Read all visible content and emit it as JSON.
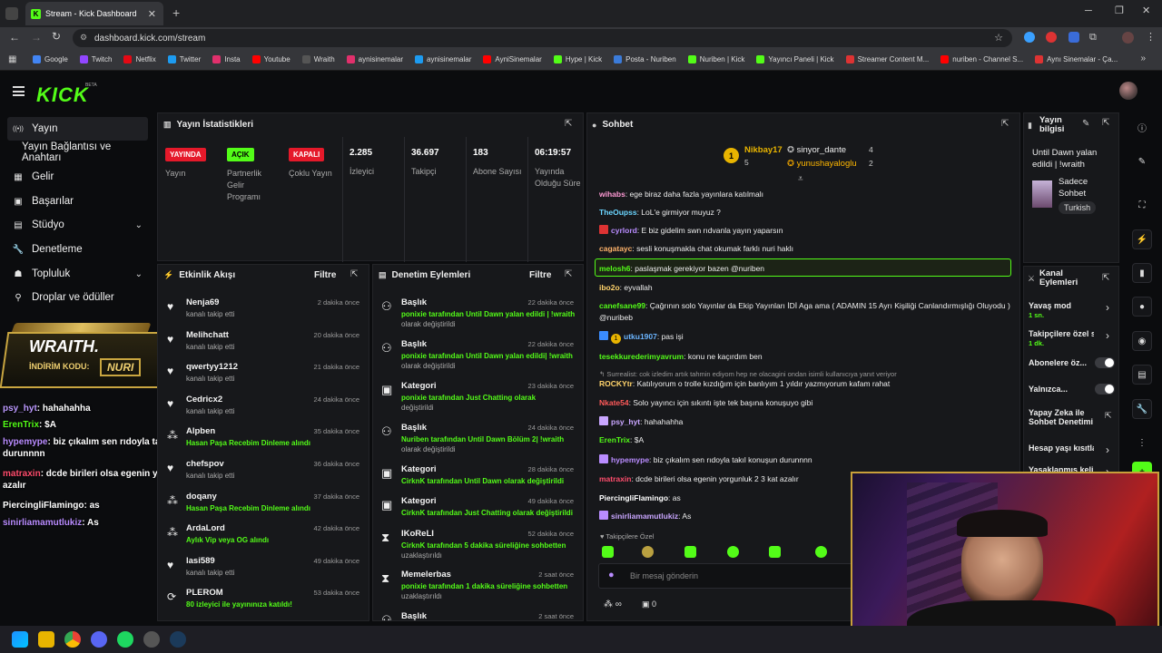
{
  "browser": {
    "tab_title": "Stream - Kick Dashboard",
    "url": "dashboard.kick.com/stream",
    "bookmarks": [
      "Google",
      "Twitch",
      "Netflix",
      "Twitter",
      "Insta",
      "Youtube",
      "Wraith",
      "aynisinemalar",
      "aynisinemalar",
      "AyniSinemalar",
      "Hype | Kick",
      "Posta - Nuriben",
      "Nuriben | Kick",
      "Yayıncı Paneli | Kick",
      "Streamer Content M...",
      "nuriben - Channel S...",
      "Aynı Sinemalar - Ça..."
    ]
  },
  "brand": {
    "logo": "KICK",
    "beta": "BETA",
    "accent": "#53fc18"
  },
  "sidebar": {
    "items": [
      {
        "label": "Yayın",
        "icon": "broadcast-icon"
      },
      {
        "label": "Yayın Bağlantısı ve Anahtarı",
        "icon": ""
      },
      {
        "label": "Gelir",
        "icon": "bank-icon"
      },
      {
        "label": "Başarılar",
        "icon": "achievements-icon"
      },
      {
        "label": "Stüdyo",
        "icon": "studio-icon"
      },
      {
        "label": "Denetleme",
        "icon": "wrench-icon"
      },
      {
        "label": "Topluluk",
        "icon": "community-icon"
      },
      {
        "label": "Droplar ve ödüller",
        "icon": "drops-icon"
      }
    ]
  },
  "overlay": {
    "wraith_title": "WRAITH.",
    "code_label": "İNDİRİM KODU:",
    "code": "NURI",
    "chat": [
      {
        "user": "psy_hyt",
        "text": ": hahahahha",
        "color": "#b9f"
      },
      {
        "user": "ErenTrix",
        "text": ": $A",
        "color": "#53fc18"
      },
      {
        "user": "hypemype",
        "text": ": biz çıkalım sen rıdoyla takıl konuşun durunnnn",
        "color": "#b98cff"
      },
      {
        "user": "matraxin",
        "text": ": dcde birileri olsa egenin yorgunluk 2 3 kat azalır",
        "color": "#ff4d6d"
      },
      {
        "user": "PiercingliFlamingo",
        "text": ": as",
        "color": "#fff"
      },
      {
        "user": "sinirliamamutlukiz",
        "text": ": As",
        "color": "#b98cff"
      }
    ]
  },
  "stats": {
    "title": "Yayın İstatistikleri",
    "items": [
      {
        "badge": "YAYINDA",
        "label": "Yayın"
      },
      {
        "badge": "AÇIK",
        "label": "Partnerlik Gelir Programı"
      },
      {
        "badge": "KAPALI",
        "label": "Çoklu Yayın"
      },
      {
        "value": "2.285",
        "label": "İzleyici"
      },
      {
        "value": "36.697",
        "label": "Takipçi"
      },
      {
        "value": "183",
        "label": "Abone Sayısı"
      },
      {
        "value": "06:19:57",
        "label": "Yayında Olduğu Süre"
      }
    ]
  },
  "activity": {
    "title": "Etkinlik Akışı",
    "filter": "Filtre",
    "items": [
      {
        "name": "Nenja69",
        "sub": "kanalı takip etti",
        "time": "2 dakika önce",
        "icon": "heart-icon"
      },
      {
        "name": "Melihchatt",
        "sub": "kanalı takip etti",
        "time": "20 dakika önce",
        "icon": "heart-icon"
      },
      {
        "name": "qwertyy1212",
        "sub": "kanalı takip etti",
        "time": "21 dakika önce",
        "icon": "heart-icon"
      },
      {
        "name": "Cedricx2",
        "sub": "kanalı takip etti",
        "time": "24 dakika önce",
        "icon": "heart-icon"
      },
      {
        "name": "Alpben",
        "sub": "Hasan Paşa Recebim Dinleme alındı",
        "time": "35 dakika önce",
        "icon": "reward-icon"
      },
      {
        "name": "chefspov",
        "sub": "kanalı takip etti",
        "time": "36 dakika önce",
        "icon": "heart-icon"
      },
      {
        "name": "doqany",
        "sub": "Hasan Paşa Recebim Dinleme alındı",
        "time": "37 dakika önce",
        "icon": "reward-icon"
      },
      {
        "name": "ArdaLord",
        "sub": "Aylık Vip veya OG alındı",
        "time": "42 dakika önce",
        "icon": "reward-icon"
      },
      {
        "name": "lasi589",
        "sub": "kanalı takip etti",
        "time": "49 dakika önce",
        "icon": "heart-icon"
      },
      {
        "name": "PLEROM",
        "sub": "80 izleyici ile yayınınıza katıldı!",
        "time": "53 dakika önce",
        "icon": "host-icon"
      }
    ]
  },
  "moderation": {
    "title": "Denetim Eylemleri",
    "filter": "Filtre",
    "items": [
      {
        "title": "Başlık",
        "line1": "ponixie tarafından Until Dawn yalan edildi | !wraith",
        "line2": "olarak değiştirildi",
        "time": "22 dakika önce",
        "icon": "user-edit-icon"
      },
      {
        "title": "Başlık",
        "line1": "ponixie tarafından Until Dawn yalan edildi| !wraith",
        "line2": "olarak değiştirildi",
        "time": "22 dakika önce",
        "icon": "user-edit-icon"
      },
      {
        "title": "Kategori",
        "line1": "ponixie tarafından Just Chatting olarak",
        "line2": "değiştirildi",
        "time": "23 dakika önce",
        "icon": "category-icon"
      },
      {
        "title": "Başlık",
        "line1": "Nuriben tarafından Until Dawn Bölüm 2| !wraith",
        "line2": "olarak değiştirildi",
        "time": "24 dakika önce",
        "icon": "user-edit-icon"
      },
      {
        "title": "Kategori",
        "line1": "CirknK tarafından Until Dawn olarak değiştirildi",
        "line2": "",
        "time": "28 dakika önce",
        "icon": "category-icon"
      },
      {
        "title": "Kategori",
        "line1": "CirknK tarafından Just Chatting olarak değiştirildi",
        "line2": "",
        "time": "49 dakika önce",
        "icon": "category-icon"
      },
      {
        "title": "IKoReLI",
        "line1": "CirknK tarafından 5 dakika süreliğine sohbetten",
        "line2": "uzaklaştırıldı",
        "time": "52 dakika önce",
        "icon": "hourglass-icon"
      },
      {
        "title": "Memelerbas",
        "line1": "ponixie tarafından 1 dakika süreliğine sohbetten",
        "line2": "uzaklaştırıldı",
        "time": "2 saat önce",
        "icon": "hourglass-icon"
      },
      {
        "title": "Başlık",
        "line1": "",
        "line2": "",
        "time": "2 saat önce",
        "icon": "user-edit-icon"
      }
    ]
  },
  "chat": {
    "title": "Sohbet",
    "top_gifter": {
      "name": "Nikbay17",
      "count": "5"
    },
    "gifters": [
      {
        "name": "sinyor_dante",
        "count": "4"
      },
      {
        "name": "yunushayaloglu",
        "count": "2"
      }
    ],
    "messages": [
      {
        "user": "wihabs",
        "text": ": ege biraz daha fazla yayınlara katılmalı",
        "color": "#ff9ad5"
      },
      {
        "user": "TheOupss",
        "text": ": LoL'e girmiyor muyuz ?",
        "color": "#6bd5ff"
      },
      {
        "user": "cyrlord",
        "text": ": E biz gidelim swn rıdvanla yayın yaparsın",
        "color": "#b98cff"
      },
      {
        "user": "cagatayc",
        "text": ": sesli konuşmakla chat okumak farklı nuri haklı",
        "color": "#ffb36b"
      },
      {
        "user": "melosh6",
        "text": ": paslaşmak gerekiyor bazen @nuriben",
        "color": "#53fc18"
      },
      {
        "user": "ibo2o",
        "text": ": eyvallah",
        "color": "#ffd36b"
      },
      {
        "user": "canefsane99",
        "text": ": Çağrının solo Yayınlar da Ekip Yayınları İDİ Aga ama ( ADAMIN 15 Ayrı Kişiliği Canlandırmışlığı Oluyodu ) @nuribeb",
        "color": "#53fc18"
      },
      {
        "user": "utku1907",
        "text": ": pas işi",
        "color": "#6bb5ff"
      },
      {
        "user": "tesekkurederimyavrum",
        "text": ": konu ne kaçırdım ben",
        "color": "#53fc18"
      },
      {
        "user": "",
        "text": "Surrealist: cok izledim artık tahmin ediyom hep ne olacagini ondan isimli kullanıcıya yanıt veriyor",
        "color": "#999"
      },
      {
        "user": "ROCKYtr",
        "text": ": Katılıyorum o trolle kızdığım için banlıyım 1 yıldır yazmıyorum kafam rahat",
        "color": "#ffd36b"
      },
      {
        "user": "Nkate54",
        "text": ": Solo yayıncı için sıkıntı işte tek başına konuşuyo gibi",
        "color": "#ff5a5a"
      },
      {
        "user": "psy_hyt",
        "text": ": hahahahha",
        "color": "#c9a6ff"
      },
      {
        "user": "ErenTrix",
        "text": ": $A",
        "color": "#53fc18"
      },
      {
        "user": "hypemype",
        "text": ": biz çıkalım sen rıdoyla takıl konuşun durunnnn",
        "color": "#b98cff"
      },
      {
        "user": "matraxin",
        "text": ": dcde birileri olsa egenin yorgunluk 2 3 kat azalır",
        "color": "#ff4d6d"
      },
      {
        "user": "PiercingliFlamingo",
        "text": ": as",
        "color": "#fff"
      },
      {
        "user": "sinirliamamutlukiz",
        "text": ": As",
        "color": "#c9a6ff"
      }
    ],
    "followers_only": "Takipçilere Özel",
    "placeholder": "Bir mesaj gönderin",
    "viewer_count": "0"
  },
  "stream_info": {
    "title": "Yayın bilgisi",
    "stream_title": "Until Dawn yalan edildi | !wraith",
    "category": "Sadece Sohbet",
    "language": "Turkish"
  },
  "channel_actions": {
    "title": "Kanal Eylemleri",
    "items": [
      {
        "label": "Yavaş mod",
        "sub": "1 sn.",
        "control": "chevron"
      },
      {
        "label": "Takipçilere özel s",
        "sub": "1 dk.",
        "control": "chevron"
      },
      {
        "label": "Abonelere öz...",
        "sub": "",
        "control": "toggle"
      },
      {
        "label": "Yalnızca...",
        "sub": "",
        "control": "toggle"
      },
      {
        "label": "Yapay Zeka ile Sohbet Denetimi",
        "sub": "",
        "control": "external"
      },
      {
        "label": "Hesap yaşı kısıtla",
        "sub": "",
        "control": "chevron"
      },
      {
        "label": "Yasaklanmış kelin",
        "sub": "",
        "control": "chevron"
      }
    ]
  }
}
